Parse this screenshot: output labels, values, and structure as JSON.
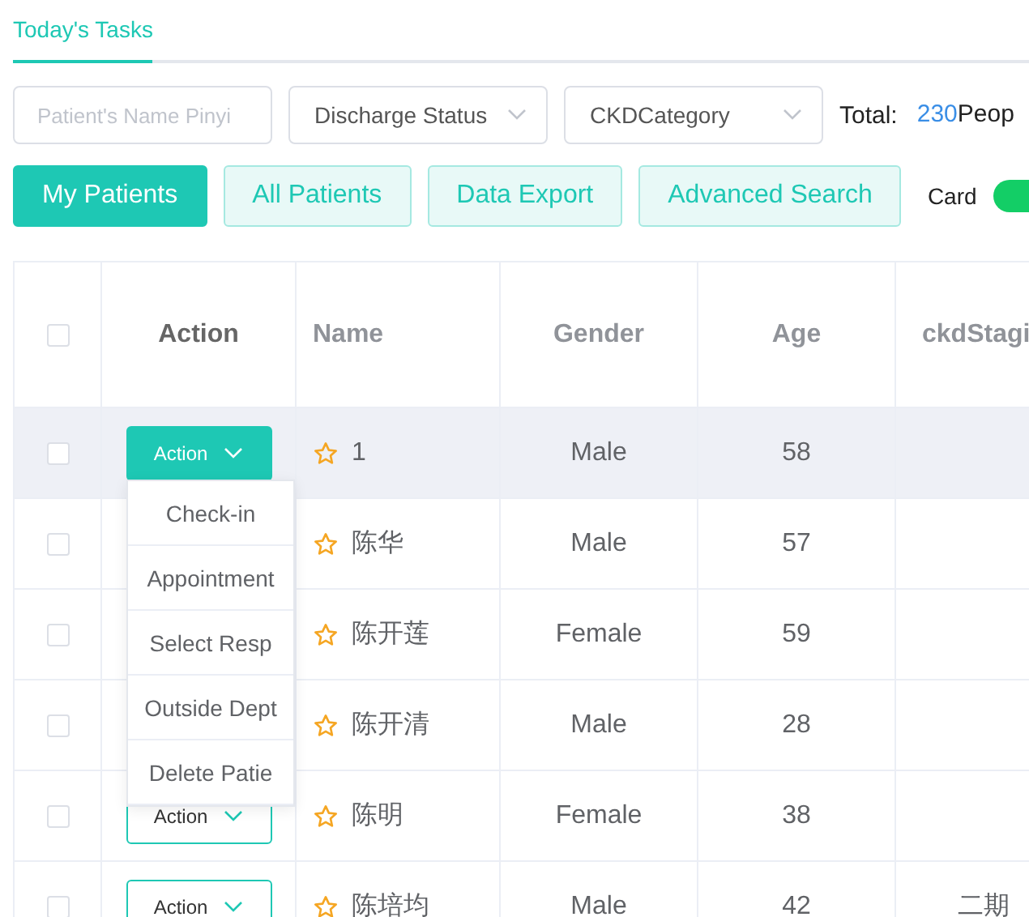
{
  "tabs": [
    {
      "label": "Today's Tasks",
      "selected": true
    }
  ],
  "filters": {
    "search": {
      "placeholder": "Patient's Name Pinyi"
    },
    "selects": [
      {
        "label": "Discharge Status"
      },
      {
        "label": "CKDCategory"
      }
    ],
    "total_label": "Total:",
    "total_count": "230",
    "total_unit": "Peop"
  },
  "buttons": [
    {
      "label": "My Patients",
      "selected": true
    },
    {
      "label": "All Patients",
      "selected": false
    },
    {
      "label": "Data Export",
      "selected": false
    },
    {
      "label": "Advanced Search",
      "selected": false
    }
  ],
  "card_switch": {
    "label": "Card",
    "on": true
  },
  "table": {
    "select_all_checked": false,
    "columns": [
      "Action",
      "Name",
      "Gender",
      "Age",
      "ckdStagi"
    ],
    "rows": [
      {
        "checked": false,
        "hovered": true,
        "action": "Action",
        "open": true,
        "name": "1",
        "gender": "Male",
        "age": "58"
      },
      {
        "checked": false,
        "hovered": false,
        "name": "陈华",
        "gender": "Male",
        "age": "57"
      },
      {
        "checked": false,
        "hovered": false,
        "name": "陈开莲",
        "gender": "Female",
        "age": "59"
      },
      {
        "checked": false,
        "hovered": false,
        "name": "陈开清",
        "gender": "Male",
        "age": "28"
      },
      {
        "checked": false,
        "hovered": false,
        "action": "Action",
        "open": false,
        "name": "陈明",
        "gender": "Female",
        "age": "38"
      },
      {
        "checked": false,
        "hovered": false,
        "action": "Action",
        "open": false,
        "name": "陈培均",
        "gender": "Male",
        "age": "42",
        "stage": "二期"
      }
    ],
    "action_menu": [
      "Check-in",
      "Appointment",
      "Select Resp",
      "Outside Dept",
      "Delete Patie"
    ]
  }
}
